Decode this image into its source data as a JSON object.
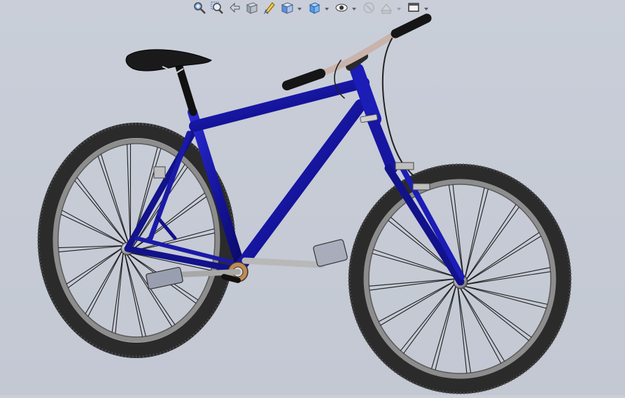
{
  "viewport": {
    "background_color": "#c7ccd7",
    "model": "bicycle-assembly"
  },
  "toolbar": {
    "buttons": [
      {
        "name": "zoom-to-fit-icon",
        "enabled": true
      },
      {
        "name": "zoom-to-area-icon",
        "enabled": true
      },
      {
        "name": "previous-view-icon",
        "enabled": true
      },
      {
        "name": "section-view-icon",
        "enabled": true
      },
      {
        "name": "dynamic-annotation-views-icon",
        "enabled": true
      },
      {
        "name": "view-orientation-icon",
        "enabled": true,
        "dropdown": true
      },
      {
        "name": "display-style-icon",
        "enabled": true,
        "dropdown": true
      },
      {
        "name": "hide-show-items-icon",
        "enabled": true,
        "dropdown": true
      },
      {
        "name": "edit-appearance-icon",
        "enabled": false
      },
      {
        "name": "apply-scene-icon",
        "enabled": false,
        "dropdown": true
      },
      {
        "name": "view-settings-icon",
        "enabled": true,
        "dropdown": true
      }
    ]
  },
  "colors": {
    "frame": "#1c1cb0",
    "frame_dark": "#0a0a6a",
    "tire": "#2a2a2a",
    "rim": "#8a8a8a",
    "spoke": "#222222",
    "handlebar": "#c9b3aa",
    "grip": "#1a1a1a"
  }
}
